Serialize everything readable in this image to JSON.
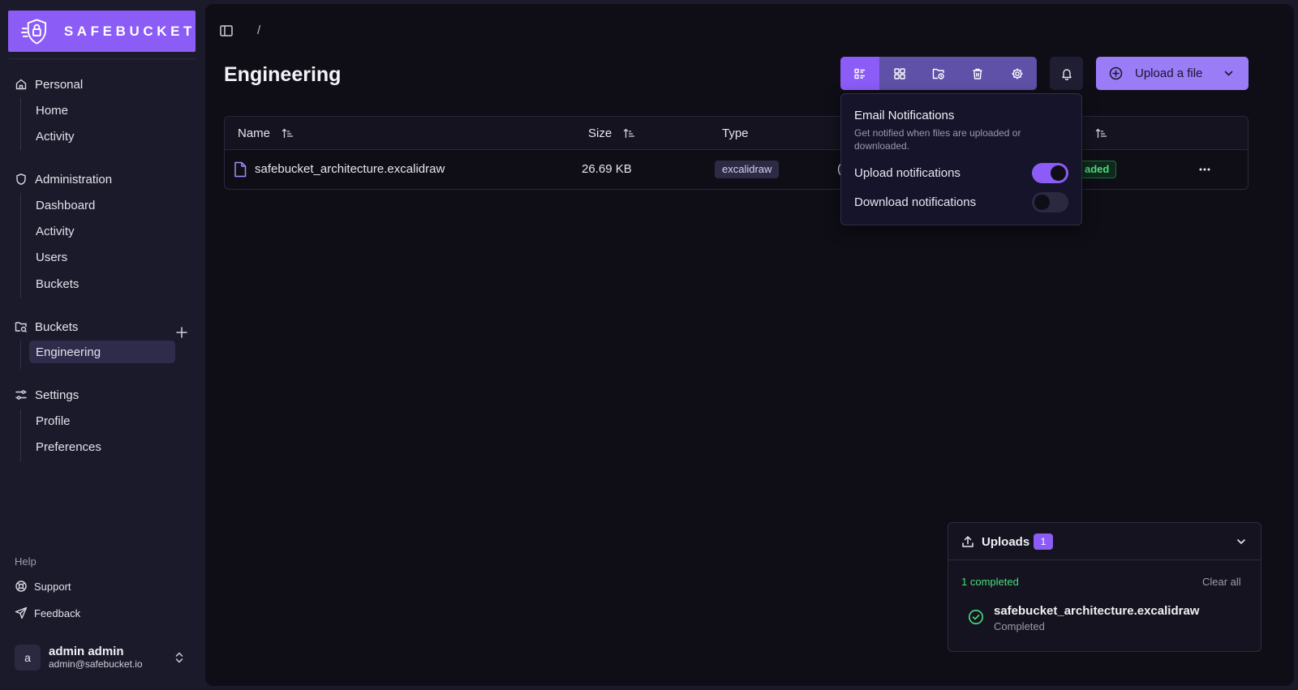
{
  "brand": {
    "name": "SAFEBUCKET"
  },
  "sidebar": {
    "groups": [
      {
        "title": "Personal",
        "items": [
          {
            "label": "Home"
          },
          {
            "label": "Activity"
          }
        ]
      },
      {
        "title": "Administration",
        "items": [
          {
            "label": "Dashboard"
          },
          {
            "label": "Activity"
          },
          {
            "label": "Users"
          },
          {
            "label": "Buckets"
          }
        ]
      },
      {
        "title": "Buckets",
        "items": [
          {
            "label": "Engineering",
            "active": true
          }
        ]
      },
      {
        "title": "Settings",
        "items": [
          {
            "label": "Profile"
          },
          {
            "label": "Preferences"
          }
        ]
      }
    ],
    "help": {
      "title": "Help",
      "support": "Support",
      "feedback": "Feedback"
    },
    "user": {
      "initial": "a",
      "name": "admin admin",
      "email": "admin@safebucket.io"
    }
  },
  "header": {
    "breadcrumb_sep": "/",
    "title": "Engineering",
    "upload_label": "Upload a file"
  },
  "table": {
    "columns": {
      "name": "Name",
      "size": "Size",
      "type": "Type"
    },
    "rows": [
      {
        "name": "safebucket_architecture.excalidraw",
        "size": "26.69 KB",
        "type": "excalidraw",
        "date_fragment": "(",
        "status_fragment": "aded"
      }
    ]
  },
  "notifications": {
    "title": "Email Notifications",
    "description": "Get notified when files are uploaded or downloaded.",
    "upload_label": "Upload notifications",
    "upload_enabled": true,
    "download_label": "Download notifications",
    "download_enabled": false
  },
  "uploads": {
    "title": "Uploads",
    "count": "1",
    "completed_text": "1 completed",
    "clear_label": "Clear all",
    "items": [
      {
        "name": "safebucket_architecture.excalidraw",
        "status": "Completed"
      }
    ]
  },
  "colors": {
    "accent": "#8b5cf6",
    "success": "#4ade80",
    "background": "#0f0e17",
    "sidebar": "#1b1a2b"
  }
}
